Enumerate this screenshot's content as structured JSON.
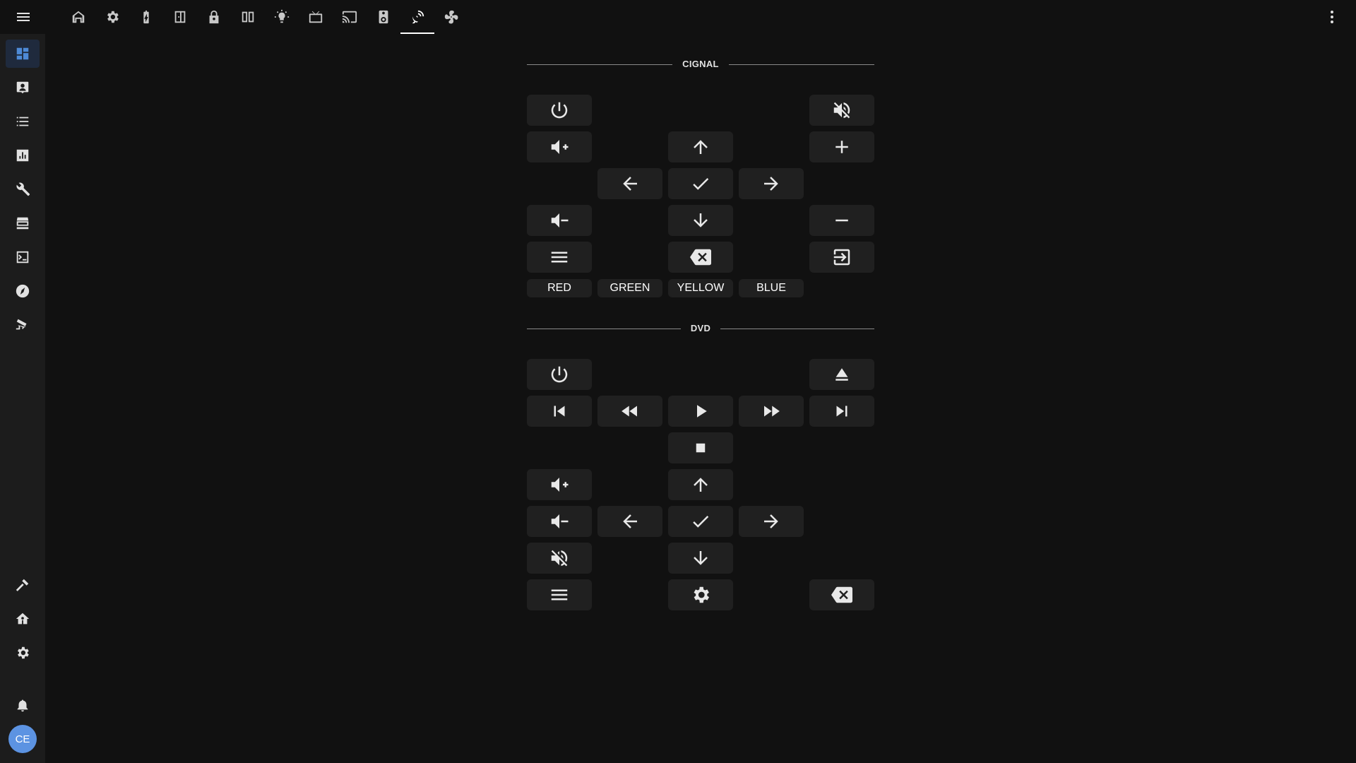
{
  "topbar": {
    "menu_icon": "menu-icon",
    "more_icon": "dots-vertical-icon",
    "tabs": [
      {
        "icon": "home-icon",
        "active": false
      },
      {
        "icon": "gear-icon",
        "active": false
      },
      {
        "icon": "battery-charging-icon",
        "active": false
      },
      {
        "icon": "door-icon",
        "active": false
      },
      {
        "icon": "lock-icon",
        "active": false
      },
      {
        "icon": "blinds-icon",
        "active": false
      },
      {
        "icon": "lightbulb-icon",
        "active": false
      },
      {
        "icon": "television-icon",
        "active": false
      },
      {
        "icon": "cast-icon",
        "active": false
      },
      {
        "icon": "speaker-icon",
        "active": false
      },
      {
        "icon": "satellite-dish-icon",
        "active": true
      },
      {
        "icon": "fan-icon",
        "active": false
      }
    ]
  },
  "sidebar": {
    "items": [
      {
        "icon": "dashboard-icon",
        "active": true
      },
      {
        "icon": "account-box-icon",
        "active": false
      },
      {
        "icon": "list-icon",
        "active": false
      },
      {
        "icon": "chart-box-icon",
        "active": false
      },
      {
        "icon": "wrench-icon",
        "active": false
      },
      {
        "icon": "hacs-store-icon",
        "active": false
      },
      {
        "icon": "console-icon",
        "active": false
      },
      {
        "icon": "compass-icon",
        "active": false
      },
      {
        "icon": "cctv-icon",
        "active": false
      }
    ],
    "bottom_items": [
      {
        "icon": "hammer-icon"
      },
      {
        "icon": "home-gear-icon"
      },
      {
        "icon": "cog-icon"
      }
    ],
    "notifications_icon": "bell-icon",
    "avatar_initials": "CE"
  },
  "sections": [
    {
      "title": "CIGNAL",
      "buttons": [
        {
          "icon": "power-icon"
        },
        {
          "icon": "volume-mute-icon"
        },
        {
          "icon": "volume-plus-icon"
        },
        {
          "icon": "arrow-up-icon"
        },
        {
          "icon": "plus-icon"
        },
        {
          "icon": "arrow-left-icon"
        },
        {
          "icon": "check-icon"
        },
        {
          "icon": "arrow-right-icon"
        },
        {
          "icon": "volume-minus-icon"
        },
        {
          "icon": "arrow-down-icon"
        },
        {
          "icon": "minus-icon"
        },
        {
          "icon": "menu-icon"
        },
        {
          "icon": "backspace-icon"
        },
        {
          "icon": "exit-icon"
        }
      ],
      "color_buttons": [
        "RED",
        "GREEN",
        "YELLOW",
        "BLUE"
      ]
    },
    {
      "title": "DVD",
      "buttons": [
        {
          "icon": "power-icon"
        },
        {
          "icon": "eject-icon"
        },
        {
          "icon": "skip-previous-icon"
        },
        {
          "icon": "rewind-icon"
        },
        {
          "icon": "play-icon"
        },
        {
          "icon": "fast-forward-icon"
        },
        {
          "icon": "skip-next-icon"
        },
        {
          "icon": "stop-icon"
        },
        {
          "icon": "volume-plus-icon"
        },
        {
          "icon": "arrow-up-icon"
        },
        {
          "icon": "volume-minus-icon"
        },
        {
          "icon": "arrow-left-icon"
        },
        {
          "icon": "check-icon"
        },
        {
          "icon": "arrow-right-icon"
        },
        {
          "icon": "volume-mute-icon"
        },
        {
          "icon": "arrow-down-icon"
        },
        {
          "icon": "menu-icon"
        },
        {
          "icon": "settings-icon"
        },
        {
          "icon": "backspace-icon"
        }
      ]
    }
  ]
}
